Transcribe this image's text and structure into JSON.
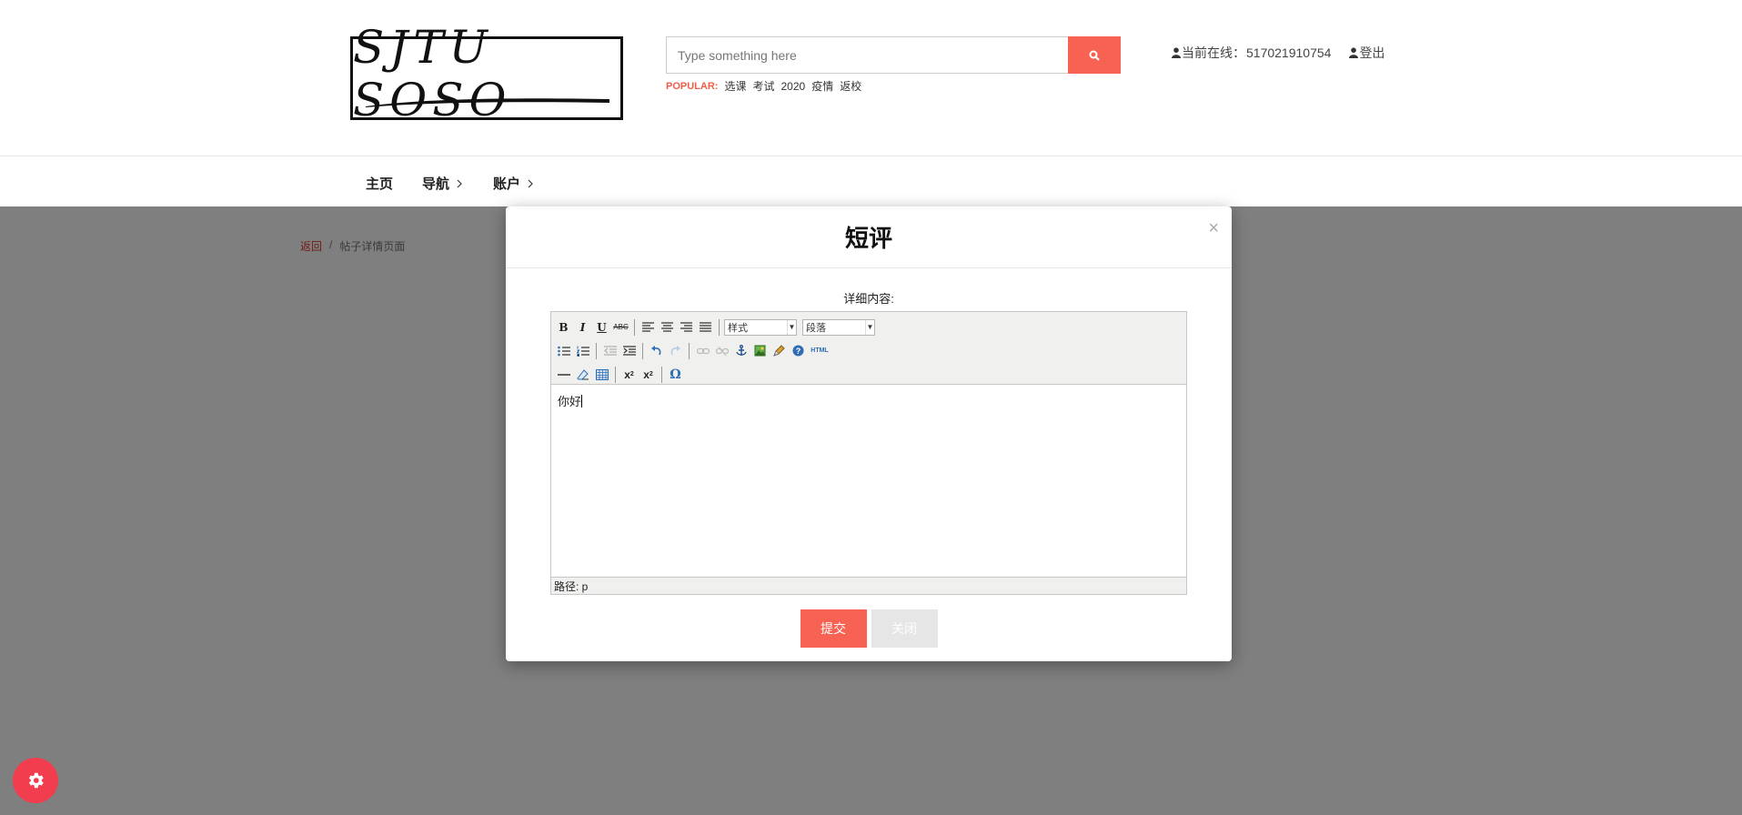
{
  "header": {
    "logo_text": "SJTU SOSO",
    "search": {
      "placeholder": "Type something here"
    },
    "popular": {
      "label": "POPULAR:",
      "tags": [
        "选课",
        "考试",
        "2020",
        "疫情",
        "返校"
      ]
    },
    "user": {
      "online_label": "当前在线：",
      "user_id": "517021910754",
      "logout_label": "登出"
    }
  },
  "nav": {
    "items": [
      "主页",
      "导航",
      "账户"
    ]
  },
  "breadcrumb": {
    "back": "返回",
    "separator": "/",
    "current": "帖子详情页面"
  },
  "modal": {
    "title": "短评",
    "close_glyph": "×",
    "field_label": "详细内容:",
    "editor": {
      "style_select": "样式",
      "format_select": "段落",
      "content": "你好",
      "status_path": "路径: p",
      "html_button": "HTML"
    },
    "submit_label": "提交",
    "close_label": "关闭"
  },
  "colors": {
    "accent": "#f76252",
    "fab": "#f23d4f",
    "popular": "#f25c48"
  }
}
